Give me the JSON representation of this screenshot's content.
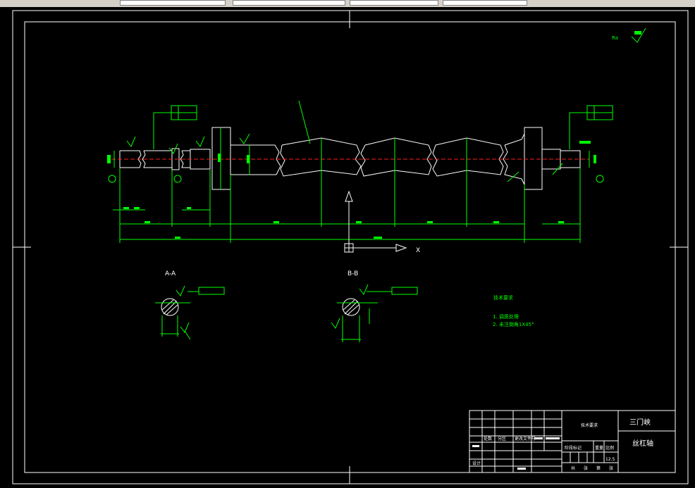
{
  "section_labels": {
    "a": "A-A",
    "b": "B-B"
  },
  "tech_title": "技术要求",
  "tech_notes": [
    "1. 调质处理",
    "2. 未注倒角1X45°"
  ],
  "title_block": {
    "left_name": "技术要求",
    "right_top": "三门峡",
    "right_mid": "丝杠轴",
    "scale": "12.5",
    "header_row": [
      "标记",
      "处数",
      "分区",
      "更改文件号",
      "签名",
      "年月日"
    ],
    "bottom_row": [
      "设计",
      "标准化",
      "",
      "阶段标记",
      "重量",
      "比例"
    ],
    "footer_row": [
      "共",
      "张",
      "第",
      "张"
    ]
  },
  "axis_label": "X",
  "colors": {
    "line": "#ffffff",
    "dim": "#00ff00",
    "center": "#ff2020",
    "bg": "#000000"
  },
  "icons": {
    "ucs": "ucs-icon",
    "view": "view-arrow-icon"
  }
}
